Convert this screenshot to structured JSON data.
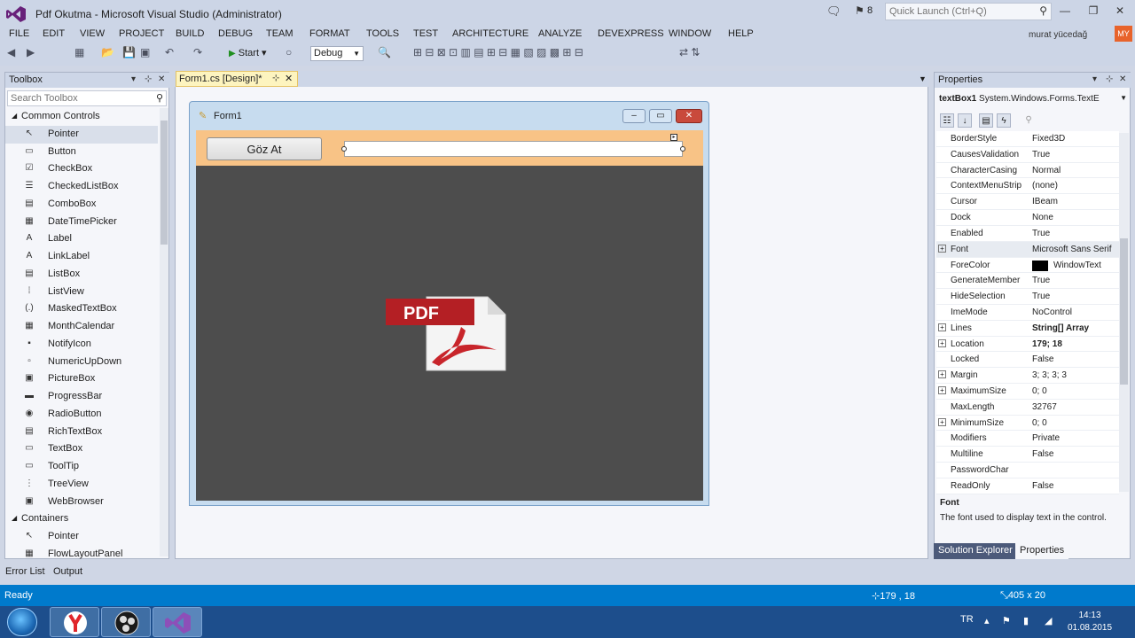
{
  "window": {
    "title": "Pdf Okutma - Microsoft Visual Studio (Administrator)",
    "notification_count": "8",
    "quick_launch_placeholder": "Quick Launch (Ctrl+Q)",
    "user_name": "murat yücedağ",
    "user_initials": "MY"
  },
  "menu": [
    "FILE",
    "EDIT",
    "VIEW",
    "PROJECT",
    "BUILD",
    "DEBUG",
    "TEAM",
    "FORMAT",
    "TOOLS",
    "TEST",
    "ARCHITECTURE",
    "ANALYZE",
    "DEVEXPRESS",
    "WINDOW",
    "HELP"
  ],
  "toolbar": {
    "start_label": "Start",
    "config": "Debug"
  },
  "toolbox": {
    "title": "Toolbox",
    "search_placeholder": "Search Toolbox",
    "items": [
      {
        "type": "category",
        "label": "Common Controls"
      },
      {
        "type": "item",
        "label": "Pointer",
        "icon": "pointer-icon",
        "selected": true
      },
      {
        "type": "item",
        "label": "Button",
        "icon": "button-icon"
      },
      {
        "type": "item",
        "label": "CheckBox",
        "icon": "checkbox-icon"
      },
      {
        "type": "item",
        "label": "CheckedListBox",
        "icon": "checked-list-icon"
      },
      {
        "type": "item",
        "label": "ComboBox",
        "icon": "combobox-icon"
      },
      {
        "type": "item",
        "label": "DateTimePicker",
        "icon": "datetime-icon"
      },
      {
        "type": "item",
        "label": "Label",
        "icon": "label-icon"
      },
      {
        "type": "item",
        "label": "LinkLabel",
        "icon": "linklabel-icon"
      },
      {
        "type": "item",
        "label": "ListBox",
        "icon": "listbox-icon"
      },
      {
        "type": "item",
        "label": "ListView",
        "icon": "listview-icon"
      },
      {
        "type": "item",
        "label": "MaskedTextBox",
        "icon": "masked-textbox-icon"
      },
      {
        "type": "item",
        "label": "MonthCalendar",
        "icon": "calendar-icon"
      },
      {
        "type": "item",
        "label": "NotifyIcon",
        "icon": "notify-icon"
      },
      {
        "type": "item",
        "label": "NumericUpDown",
        "icon": "numeric-icon"
      },
      {
        "type": "item",
        "label": "PictureBox",
        "icon": "picture-icon"
      },
      {
        "type": "item",
        "label": "ProgressBar",
        "icon": "progress-icon"
      },
      {
        "type": "item",
        "label": "RadioButton",
        "icon": "radio-icon"
      },
      {
        "type": "item",
        "label": "RichTextBox",
        "icon": "richtext-icon"
      },
      {
        "type": "item",
        "label": "TextBox",
        "icon": "textbox-icon"
      },
      {
        "type": "item",
        "label": "ToolTip",
        "icon": "tooltip-icon"
      },
      {
        "type": "item",
        "label": "TreeView",
        "icon": "treeview-icon"
      },
      {
        "type": "item",
        "label": "WebBrowser",
        "icon": "browser-icon"
      },
      {
        "type": "category",
        "label": "Containers"
      },
      {
        "type": "item",
        "label": "Pointer",
        "icon": "pointer-icon"
      },
      {
        "type": "item",
        "label": "FlowLayoutPanel",
        "icon": "flow-panel-icon"
      }
    ]
  },
  "document": {
    "tab_label": "Form1.cs [Design]*",
    "form_title": "Form1",
    "browse_button": "Göz At",
    "pdf_logo_text": "PDF"
  },
  "properties": {
    "title": "Properties",
    "object_name": "textBox1",
    "object_type": "System.Windows.Forms.TextE",
    "rows": [
      {
        "name": "BorderStyle",
        "value": "Fixed3D"
      },
      {
        "name": "CausesValidation",
        "value": "True"
      },
      {
        "name": "CharacterCasing",
        "value": "Normal"
      },
      {
        "name": "ContextMenuStrip",
        "value": "(none)"
      },
      {
        "name": "Cursor",
        "value": "IBeam"
      },
      {
        "name": "Dock",
        "value": "None"
      },
      {
        "name": "Enabled",
        "value": "True"
      },
      {
        "name": "Font",
        "value": "Microsoft Sans Serif",
        "expand": true,
        "selected": true
      },
      {
        "name": "ForeColor",
        "value": "WindowText",
        "swatch": "#000000"
      },
      {
        "name": "GenerateMember",
        "value": "True"
      },
      {
        "name": "HideSelection",
        "value": "True"
      },
      {
        "name": "ImeMode",
        "value": "NoControl"
      },
      {
        "name": "Lines",
        "value": "String[] Array",
        "expand": true,
        "bold": true
      },
      {
        "name": "Location",
        "value": "179; 18",
        "expand": true,
        "bold": true
      },
      {
        "name": "Locked",
        "value": "False"
      },
      {
        "name": "Margin",
        "value": "3; 3; 3; 3",
        "expand": true
      },
      {
        "name": "MaximumSize",
        "value": "0; 0",
        "expand": true
      },
      {
        "name": "MaxLength",
        "value": "32767"
      },
      {
        "name": "MinimumSize",
        "value": "0; 0",
        "expand": true
      },
      {
        "name": "Modifiers",
        "value": "Private"
      },
      {
        "name": "Multiline",
        "value": "False"
      },
      {
        "name": "PasswordChar",
        "value": ""
      },
      {
        "name": "ReadOnly",
        "value": "False"
      }
    ],
    "desc_title": "Font",
    "desc_text": "The font used to display text in the control.",
    "tab_solution": "Solution Explorer",
    "tab_properties": "Properties"
  },
  "bottom_tabs": [
    "Error List",
    "Output"
  ],
  "status": {
    "text": "Ready",
    "position": "179 , 18",
    "size": "405 x 20"
  },
  "taskbar": {
    "lang": "TR",
    "time": "14:13",
    "date": "01.08.2015"
  }
}
